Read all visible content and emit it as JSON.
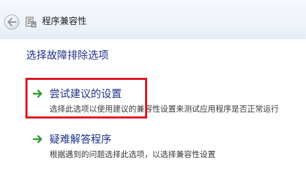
{
  "window": {
    "title": "程序兼容性"
  },
  "nav": {
    "back_icon": "back-arrow-icon",
    "app_icon": "compatibility-wizard-icon"
  },
  "main": {
    "heading": "选择故障排除选项",
    "options": [
      {
        "label": "尝试建议的设置",
        "description": "选择此选项以使用建议的兼容性设置来测试应用程序是否正常运行",
        "icon": "green-arrow-icon",
        "highlighted": true
      },
      {
        "label": "疑难解答程序",
        "description": "根据遇到的问题选择此选项，以选择兼容性设置",
        "icon": "green-arrow-icon",
        "highlighted": false
      }
    ]
  },
  "colors": {
    "link_blue": "#1e3287",
    "arrow_green": "#2f9e2f",
    "highlight_red": "#e1121c"
  }
}
